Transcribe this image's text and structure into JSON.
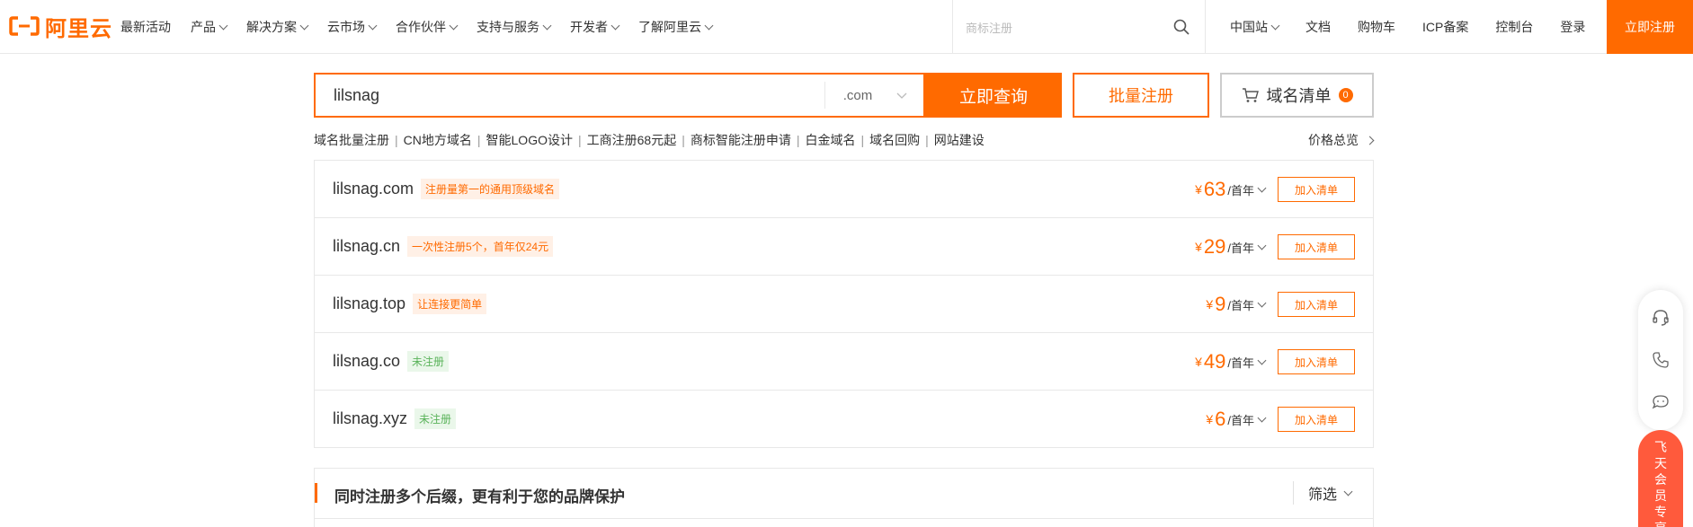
{
  "header": {
    "logo_text": "阿里云",
    "nav": [
      {
        "label": "最新活动",
        "has_chevron": false
      },
      {
        "label": "产品",
        "has_chevron": true
      },
      {
        "label": "解决方案",
        "has_chevron": true
      },
      {
        "label": "云市场",
        "has_chevron": true
      },
      {
        "label": "合作伙伴",
        "has_chevron": true
      },
      {
        "label": "支持与服务",
        "has_chevron": true
      },
      {
        "label": "开发者",
        "has_chevron": true
      },
      {
        "label": "了解阿里云",
        "has_chevron": true
      }
    ],
    "search_placeholder": "商标注册",
    "region": "中国站",
    "docs": "文档",
    "cart": "购物车",
    "icp": "ICP备案",
    "console": "控制台",
    "login": "登录",
    "register": "立即注册"
  },
  "domain_search": {
    "query": "lilsnag",
    "suffix": ".com",
    "query_button": "立即查询",
    "batch_button": "批量注册",
    "cart_label": "域名清单",
    "cart_count": "0"
  },
  "quick_links": [
    "域名批量注册",
    "CN地方域名",
    "智能LOGO设计",
    "工商注册68元起",
    "商标智能注册申请",
    "白金域名",
    "域名回购",
    "网站建设"
  ],
  "price_overview": "价格总览",
  "results": [
    {
      "domain": "lilsnag.com",
      "tag": "注册量第一的通用顶级域名",
      "tag_style": "orange",
      "currency": "¥",
      "price": "63",
      "unit": "/首年",
      "button": "加入清单"
    },
    {
      "domain": "lilsnag.cn",
      "tag": "一次性注册5个，首年仅24元",
      "tag_style": "orange",
      "currency": "¥",
      "price": "29",
      "unit": "/首年",
      "button": "加入清单"
    },
    {
      "domain": "lilsnag.top",
      "tag": "让连接更简单",
      "tag_style": "orange",
      "currency": "¥",
      "price": "9",
      "unit": "/首年",
      "button": "加入清单"
    },
    {
      "domain": "lilsnag.co",
      "tag": "未注册",
      "tag_style": "green",
      "currency": "¥",
      "price": "49",
      "unit": "/首年",
      "button": "加入清单"
    },
    {
      "domain": "lilsnag.xyz",
      "tag": "未注册",
      "tag_style": "green",
      "currency": "¥",
      "price": "6",
      "unit": "/首年",
      "button": "加入清单"
    }
  ],
  "promo": {
    "title": "同时注册多个后缀，更有利于您的品牌保护",
    "filter": "筛选"
  },
  "float_bar": {
    "icons": [
      "headset-icon",
      "phone-icon",
      "chat-bubble-icon"
    ],
    "vip_label": "飞天会员专享"
  },
  "colors": {
    "accent": "#ff6a00",
    "success": "#5ab35a",
    "vip": "#ff5a3c"
  }
}
